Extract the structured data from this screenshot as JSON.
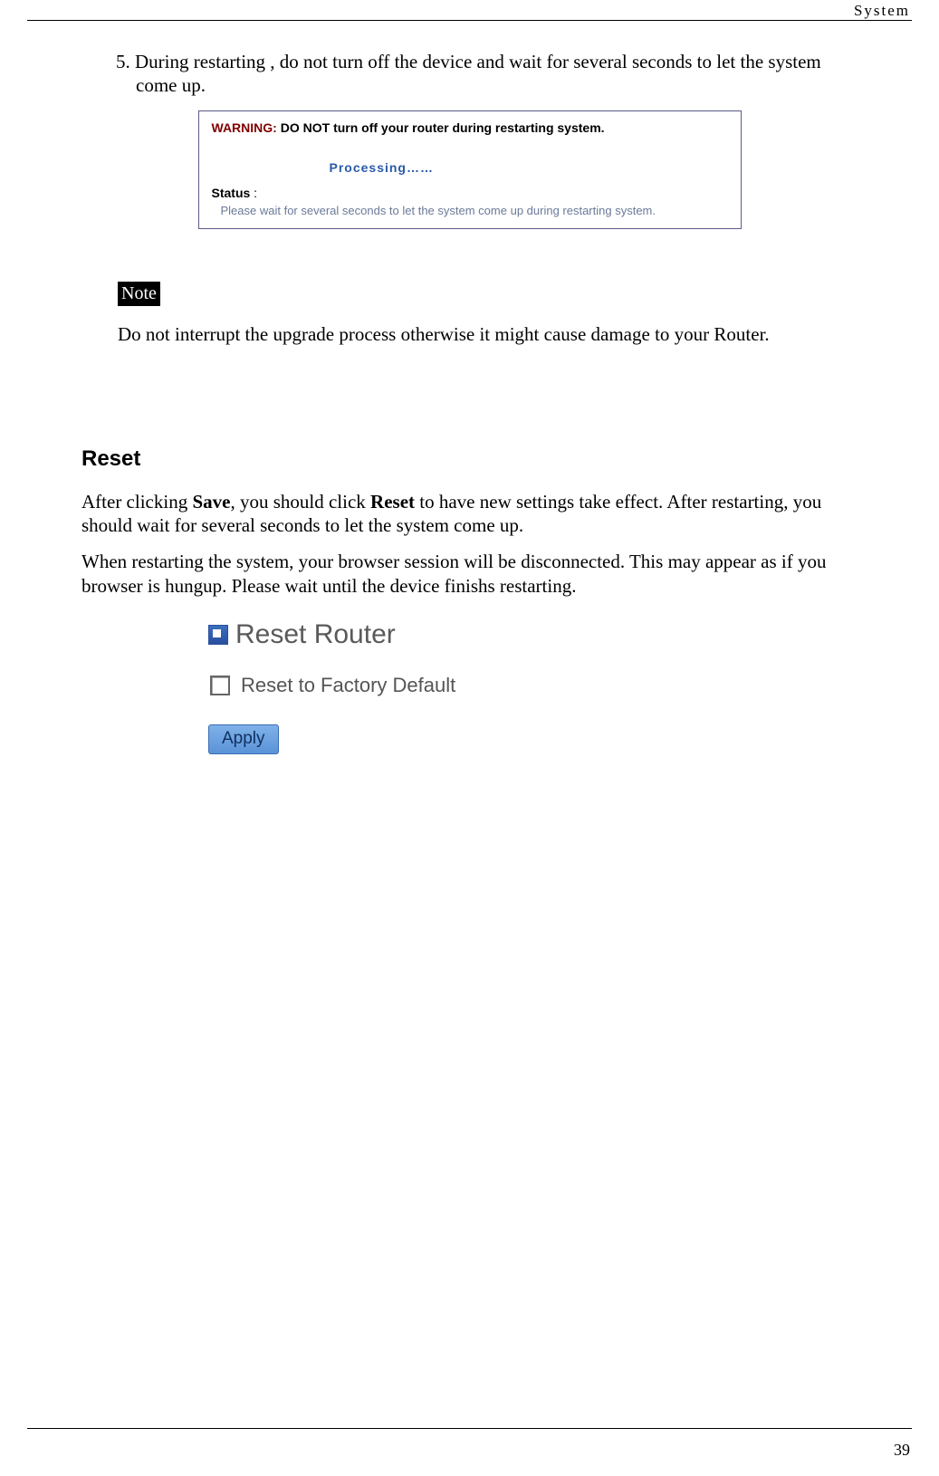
{
  "header": {
    "label": "System"
  },
  "step": {
    "number": "5.",
    "text": "During restarting , do not turn off the device and wait for several seconds to let the system come up."
  },
  "warning": {
    "prefix": "WARNING:",
    "donot": "DO NOT",
    "rest": "turn off your router during restarting system.",
    "processing": "Processing……",
    "status_label": "Status",
    "status_colon": " :",
    "status_text": "Please wait for several seconds to let the system come up during restarting system."
  },
  "note": {
    "badge": "Note",
    "text": "Do not interrupt the upgrade process otherwise it might cause damage to your Router."
  },
  "reset_section": {
    "heading": "Reset",
    "para1_a": "After clicking ",
    "para1_b": "Save",
    "para1_c": ", you should click ",
    "para1_d": "Reset",
    "para1_e": " to have new settings take effect. After restarting, you should wait for several seconds to let the system come up.",
    "para2": "When restarting the system, your browser session will be disconnected. This may appear as if you browser is hungup. Please wait until the device finishs restarting."
  },
  "reset_panel": {
    "title": "Reset Router",
    "checkbox_label": "Reset to Factory Default",
    "apply": "Apply"
  },
  "footer": {
    "page": "39"
  }
}
